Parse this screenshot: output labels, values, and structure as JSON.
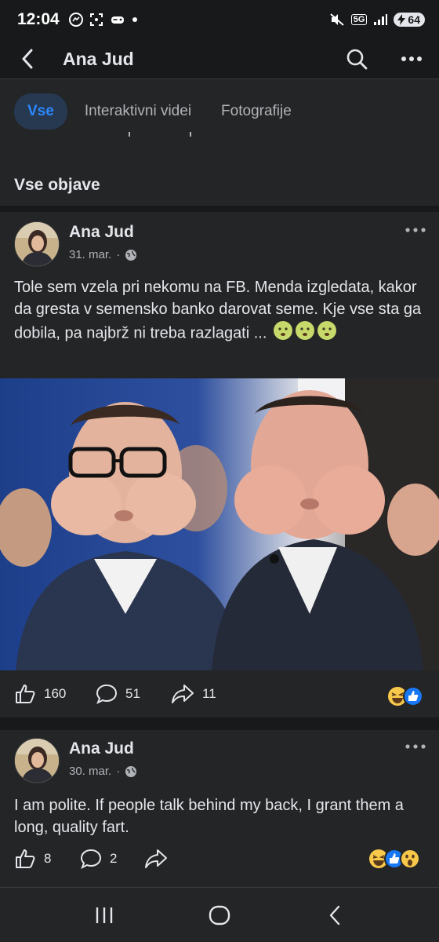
{
  "status": {
    "time": "12:04",
    "battery": "64",
    "network": "5G"
  },
  "header": {
    "title": "Ana Jud"
  },
  "tabs": [
    {
      "label": "Vse"
    },
    {
      "label": "Interaktivni videi"
    },
    {
      "label": "Fotografije"
    }
  ],
  "section_title": "Vse objave",
  "posts": [
    {
      "author": "Ana Jud",
      "date": "31. mar.",
      "separator": "·",
      "text": "Tole sem vzela pri nekomu na FB. Menda izgledata, kakor da gresta v semensko banko darovat seme. Kje vse sta ga dobila, pa najbrž ni treba razlagati ...",
      "likes": "160",
      "comments": "51",
      "shares": "11"
    },
    {
      "author": "Ana Jud",
      "date": "30. mar.",
      "separator": "·",
      "text": "I am polite. If people talk behind my back, I grant them a long, quality fart.",
      "likes": "8",
      "comments": "2"
    }
  ],
  "colors": {
    "background": "#242526",
    "accent": "#2d88ff",
    "tab_active_bg": "#263951"
  }
}
